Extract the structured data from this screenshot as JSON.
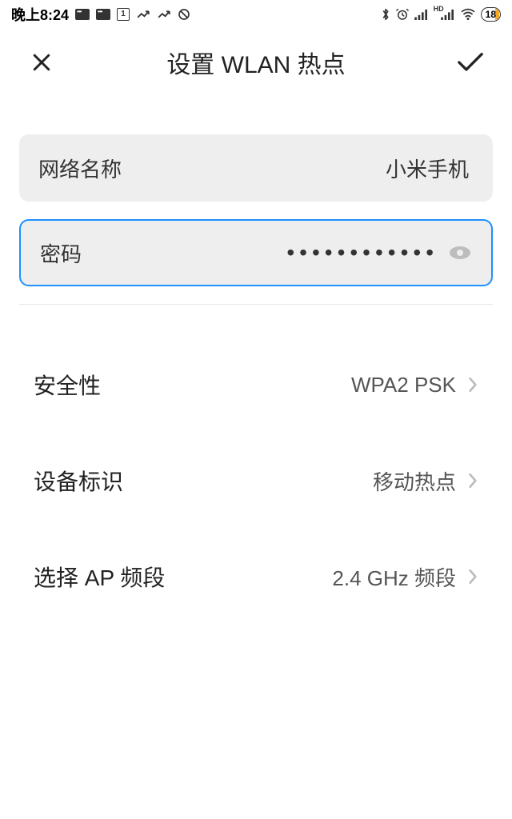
{
  "status_bar": {
    "time": "晚上8:24",
    "battery": "18"
  },
  "header": {
    "title": "设置 WLAN 热点"
  },
  "fields": {
    "network_name": {
      "label": "网络名称",
      "value": "小米手机"
    },
    "password": {
      "label": "密码",
      "masked": "••••••••••••"
    }
  },
  "settings": {
    "security": {
      "label": "安全性",
      "value": "WPA2 PSK"
    },
    "device_id": {
      "label": "设备标识",
      "value": "移动热点"
    },
    "ap_band": {
      "label": "选择 AP 频段",
      "value": "2.4 GHz 频段"
    }
  }
}
